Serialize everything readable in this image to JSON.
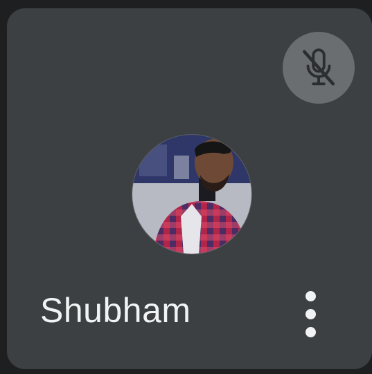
{
  "participant": {
    "name": "Shubham",
    "muted": true
  },
  "icons": {
    "mute": "mic-off-icon",
    "more": "more-vert-icon"
  },
  "colors": {
    "tile_background": "#3c4043",
    "page_background": "#1e1f21",
    "mute_badge": "#6b6e71",
    "text": "#f1f3f4"
  }
}
